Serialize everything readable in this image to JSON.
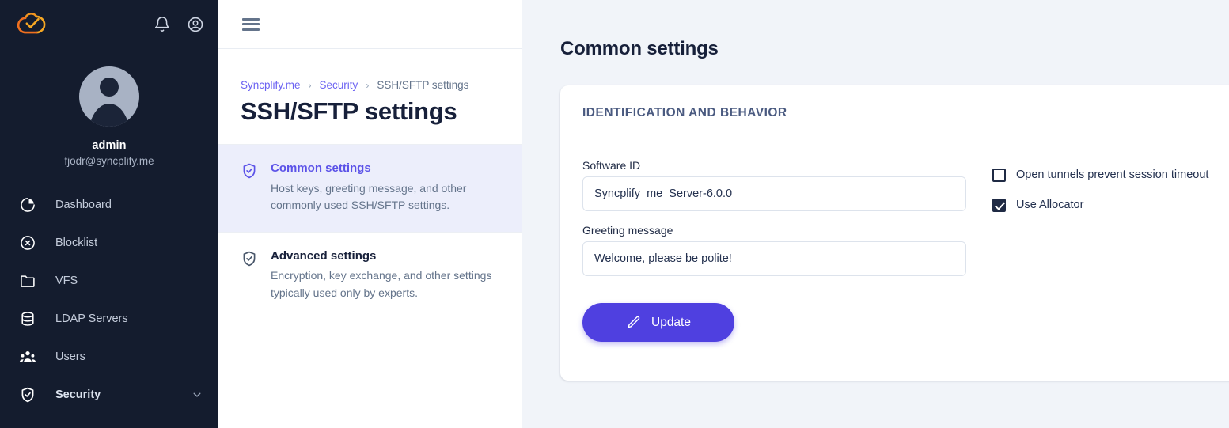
{
  "sidebar": {
    "logo_icon": "syncplify-cloud-logo",
    "brand_color": "#f59120",
    "top_actions": [
      {
        "name": "notifications-icon",
        "icon": "bell-icon"
      },
      {
        "name": "account-icon",
        "icon": "user-circle-icon"
      }
    ],
    "profile": {
      "avatar_icon": "user-avatar",
      "name": "admin",
      "email": "fjodr@syncplify.me"
    },
    "items": [
      {
        "label": "Dashboard",
        "icon": "pie-chart-icon",
        "active": false,
        "expandable": false
      },
      {
        "label": "Blocklist",
        "icon": "x-circle-icon",
        "active": false,
        "expandable": false
      },
      {
        "label": "VFS",
        "icon": "folder-icon",
        "active": false,
        "expandable": false
      },
      {
        "label": "LDAP Servers",
        "icon": "database-icon",
        "active": false,
        "expandable": false
      },
      {
        "label": "Users",
        "icon": "users-icon",
        "active": false,
        "expandable": false
      },
      {
        "label": "Security",
        "icon": "shield-check-icon",
        "active": true,
        "expandable": true
      }
    ]
  },
  "topbar": {
    "menu_icon": "hamburger-menu-icon"
  },
  "page": {
    "breadcrumb": [
      {
        "label": "Syncplify.me",
        "link": true
      },
      {
        "label": "Security",
        "link": true
      },
      {
        "label": "SSH/SFTP settings",
        "link": false
      }
    ],
    "breadcrumb_separator": "›",
    "title": "SSH/SFTP settings"
  },
  "settings_list": [
    {
      "title": "Common settings",
      "desc": "Host keys, greeting message, and other commonly used SSH/SFTP settings.",
      "icon": "shield-check-icon",
      "active": true
    },
    {
      "title": "Advanced settings",
      "desc": "Encryption, key exchange, and other settings typically used only by experts.",
      "icon": "shield-check-icon",
      "active": false
    }
  ],
  "main": {
    "title": "Common settings",
    "card": {
      "section_title": "IDENTIFICATION AND BEHAVIOR",
      "fields": [
        {
          "label": "Software ID",
          "value": "Syncplify_me_Server-6.0.0",
          "placeholder": ""
        },
        {
          "label": "Greeting message",
          "value": "Welcome, please be polite!",
          "placeholder": ""
        }
      ],
      "checkboxes": [
        {
          "label": "Open tunnels prevent session timeout",
          "checked": false
        },
        {
          "label": "Use Allocator",
          "checked": true
        }
      ],
      "submit": {
        "label": "Update",
        "icon": "pencil-icon",
        "color": "#4f40e0"
      }
    }
  }
}
